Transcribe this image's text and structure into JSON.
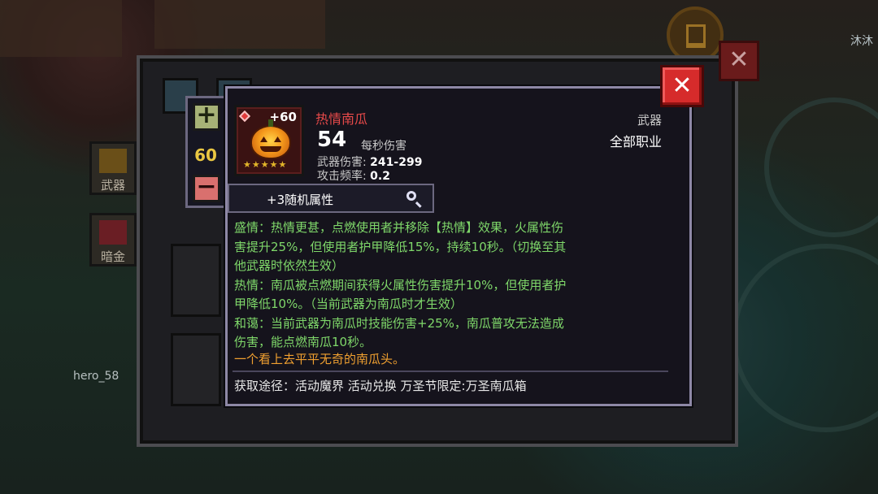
{
  "background": {
    "top_right_player": "沐沐",
    "player_name": "hero_58"
  },
  "side_tabs": [
    {
      "label": "武器"
    },
    {
      "label": "暗金"
    }
  ],
  "counter": {
    "value": "60"
  },
  "item": {
    "name": "热情南瓜",
    "enhance_level": "+60",
    "stars": "★★★★★",
    "dps_value": "54",
    "dps_label": "每秒伤害",
    "weapon_damage_label": "武器伤害:",
    "weapon_damage_value": "241-299",
    "attack_rate_label": "攻击频率:",
    "attack_rate_value": "0.2",
    "type": "武器",
    "class": "全部职业",
    "random_attr_label": "+3随机属性",
    "description": "盛情：热情更甚，点燃使用者并移除【热情】效果，火属性伤\n害提升25%，但使用者护甲降低15%，持续10秒。（切换至其\n他武器时依然生效）\n热情：南瓜被点燃期间获得火属性伤害提升10%，但使用者护\n甲降低10%。（当前武器为南瓜时才生效）\n和蔼：当前武器为南瓜时技能伤害+25%，南瓜普攻无法造成\n伤害，能点燃南瓜10秒。",
    "flavor": "一个看上去平平无奇的南瓜头。",
    "source": "获取途径：活动魔界 活动兑换 万圣节限定:万圣南瓜箱"
  },
  "colors": {
    "name": "#e84a4a",
    "description": "#7fd86a",
    "flavor": "#f0a030",
    "counter": "#e9c642",
    "close": "#d62b2b"
  },
  "icons": [
    "plus-icon",
    "minus-icon",
    "gem-icon",
    "pumpkin-icon",
    "star-icon",
    "magnifier-icon",
    "close-icon"
  ]
}
